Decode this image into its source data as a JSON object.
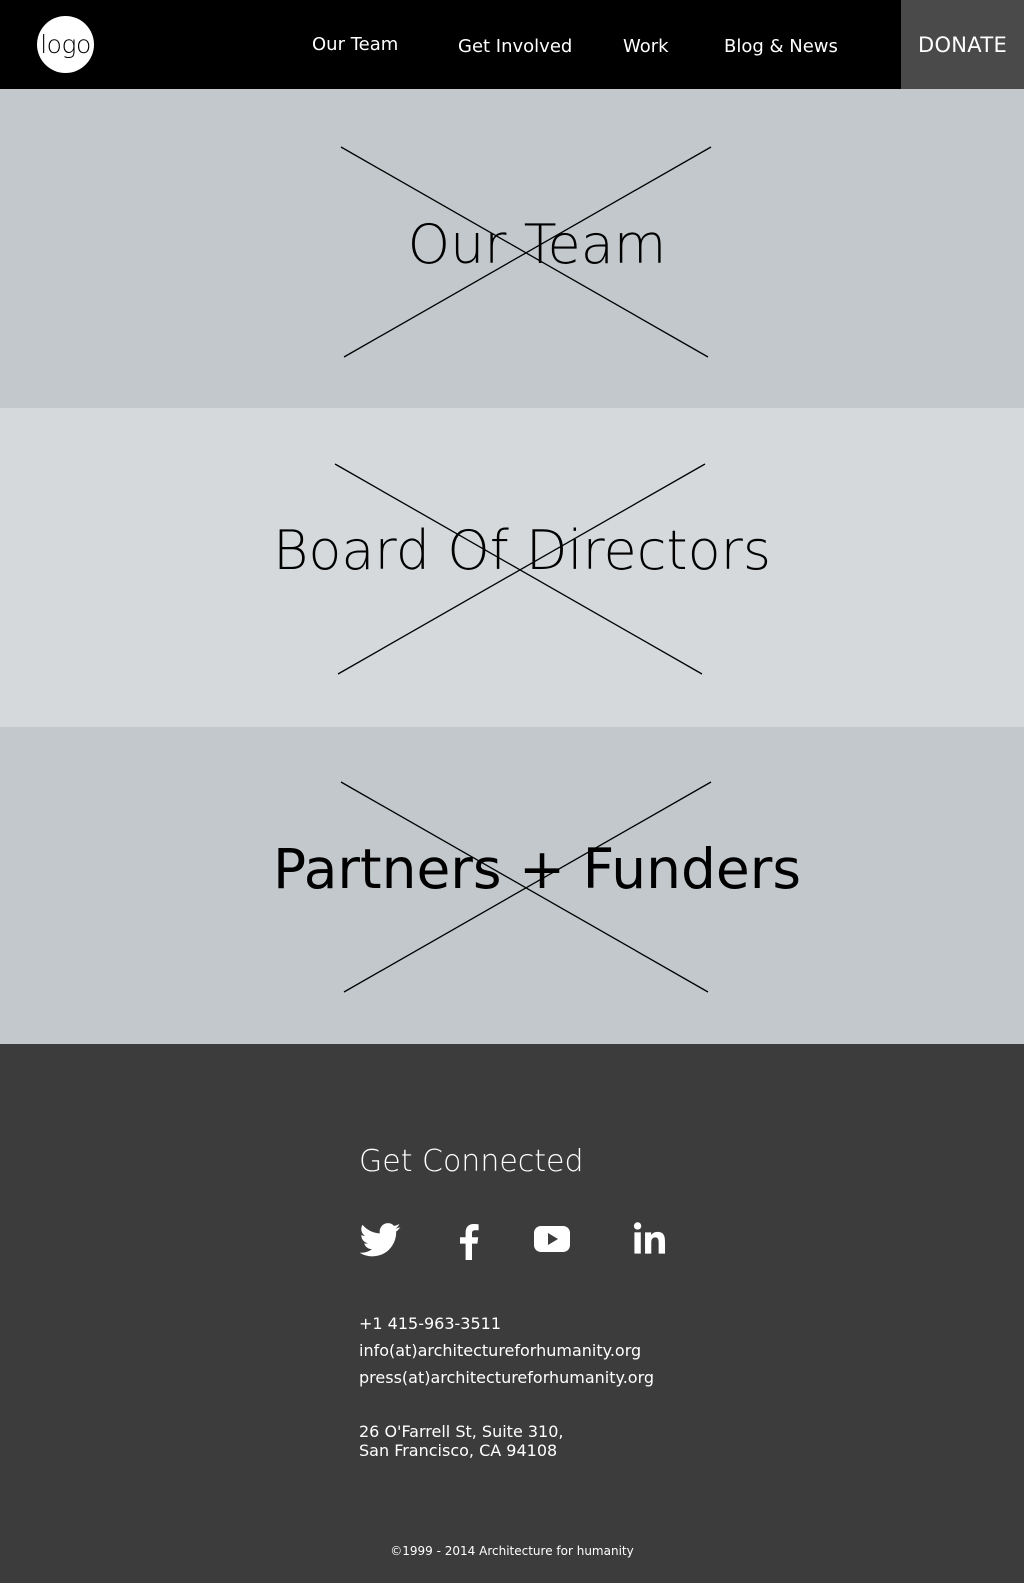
{
  "header": {
    "logo_text": "logo",
    "nav": [
      {
        "label": "Our Team"
      },
      {
        "label": "Get Involved"
      },
      {
        "label": "Work"
      },
      {
        "label": "Blog & News"
      }
    ],
    "donate_label": "DONATE"
  },
  "sections": [
    {
      "title": "Our Team",
      "bg": "#c2c8cb"
    },
    {
      "title": "Board Of Directors",
      "bg": "#d5d9db"
    },
    {
      "title": "Partners + Funders",
      "bg": "#c2c8cb"
    }
  ],
  "footer": {
    "title": "Get Connected",
    "social": [
      "twitter-icon",
      "facebook-icon",
      "youtube-icon",
      "linkedin-icon"
    ],
    "phone": "+1 415-963-3511",
    "email_info": "info(at)architectureforhumanity.org",
    "email_press": "press(at)architectureforhumanity.org",
    "address_line1": "26 O'Farrell St, Suite 310,",
    "address_line2": "San Francisco, CA 94108",
    "copyright": "©1999 - 2014 Architecture for humanity"
  },
  "colors": {
    "header_bg": "#000000",
    "donate_bg": "#4a4a4a",
    "footer_bg": "#3c3c3c"
  }
}
